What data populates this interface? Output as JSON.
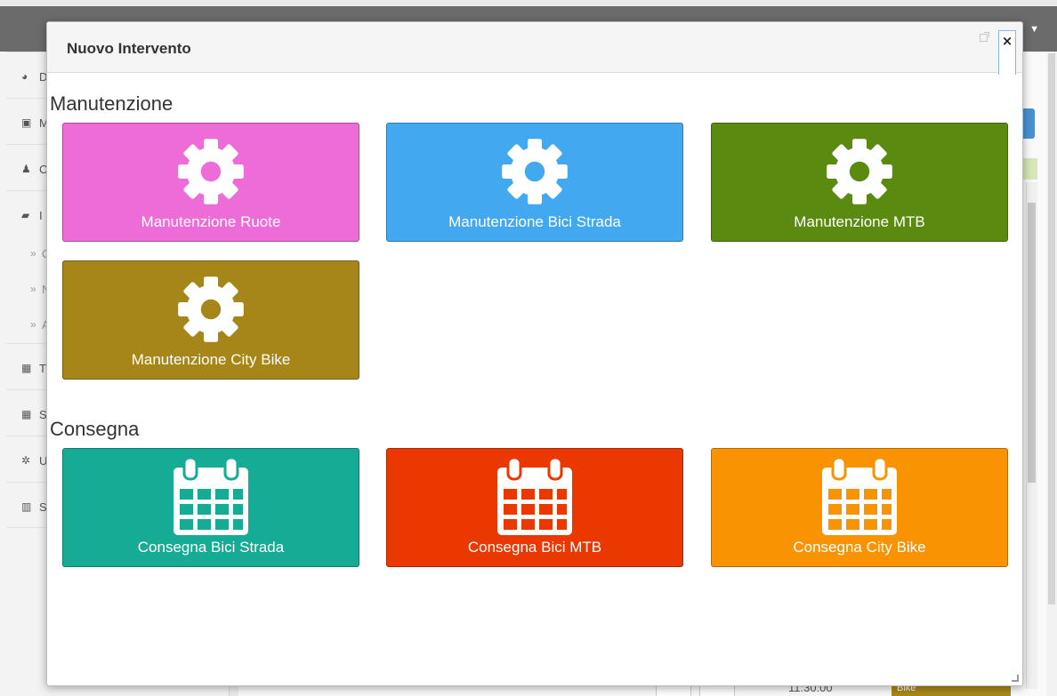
{
  "modal": {
    "title": "Nuovo Intervento",
    "close_label": "×",
    "sections": [
      {
        "title": "Manutenzione",
        "tiles": [
          {
            "label": "Manutenzione Ruote",
            "color": "#ee6cd8",
            "icon": "gear-icon"
          },
          {
            "label": "Manutenzione Bici Strada",
            "color": "#42a8ef",
            "icon": "gear-icon"
          },
          {
            "label": "Manutenzione MTB",
            "color": "#5b8a10",
            "icon": "gear-icon"
          },
          {
            "label": "Manutenzione City Bike",
            "color": "#a68618",
            "icon": "gear-icon"
          }
        ]
      },
      {
        "title": "Consegna",
        "tiles": [
          {
            "label": "Consegna Bici Strada",
            "color": "#16ab94",
            "icon": "calendar-icon"
          },
          {
            "label": "Consegna Bici MTB",
            "color": "#eb3800",
            "icon": "calendar-icon"
          },
          {
            "label": "Consegna City Bike",
            "color": "#f99302",
            "icon": "calendar-icon"
          }
        ]
      }
    ]
  },
  "background": {
    "sidebar": [
      {
        "icon": "dashboard-icon",
        "label": "D"
      },
      {
        "icon": "box-icon",
        "label": "M"
      },
      {
        "icon": "user-icon",
        "label": "C"
      },
      {
        "icon": "folder-open-icon",
        "label": "I"
      },
      {
        "icon": "chevron-right-icon",
        "label": "C"
      },
      {
        "icon": "chevron-right-icon",
        "label": "N"
      },
      {
        "icon": "chevron-right-icon",
        "label": "A"
      },
      {
        "icon": "grid-icon",
        "label": "T"
      },
      {
        "icon": "grid-icon",
        "label": "S"
      },
      {
        "icon": "gear-icon",
        "label": "U"
      },
      {
        "icon": "bar-chart-icon",
        "label": "S"
      }
    ],
    "time_text": "11:30:00",
    "cell_text": "Bike"
  }
}
